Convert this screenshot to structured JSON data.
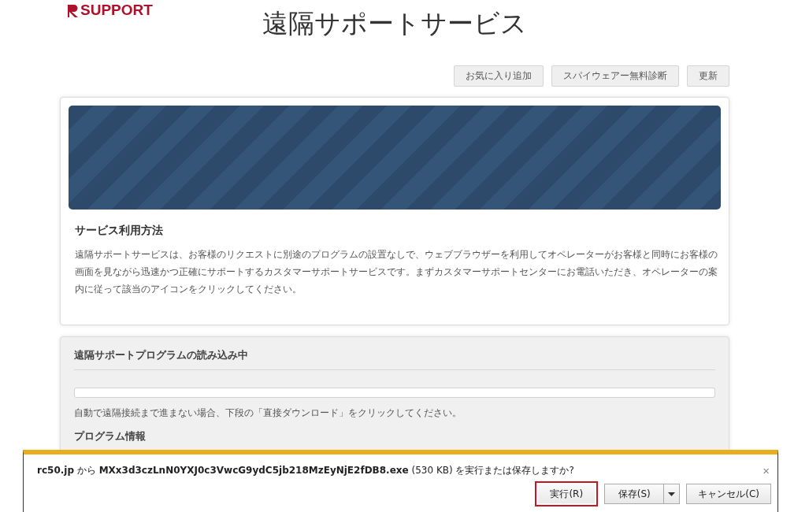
{
  "header": {
    "logo": "SUPPORT",
    "title": "遠隔サポートサービス"
  },
  "toolbar_buttons": [
    "お気に入り追加",
    "スパイウェアー無料診断",
    "更新"
  ],
  "usage_card": {
    "heading": "サービス利用方法",
    "body": "遠隔サポートサービスは、お客様のリクエストに別途のプログラムの設置なしで、ウェブブラウザーを利用してオペレーターがお客様と同時にお客様の画面を見ながら迅速かつ正確にサポートするカスタマーサポートサービスです。まずカスタマーサポートセンターにお電話いただき、オペレーターの案内に従って該当のアイコンをクリックしてください。"
  },
  "loading_card": {
    "heading": "遠隔サポートプログラムの読み込み中",
    "progress": {
      "level": 0
    },
    "note": "自動で遠隔接続まで進まない場合、下段の「直接ダウンロード」をクリックしてください。",
    "info_heading": "プログラム情報"
  },
  "download_bar": {
    "message": "**rc50.jp** から **MXx3d3czLnN0YXJ0c3VwcG9ydC5jb218MzEyNjE2fDB8.exe** (530 KB) を実行または保存しますか?",
    "close": "×",
    "buttons": [
      {
        "label": "実行(R)",
        "kind": "plain",
        "focused": true
      },
      {
        "label": "保存(S)",
        "kind": "split",
        "focused": false
      },
      {
        "label": "キャンセル(C)",
        "kind": "plain",
        "focused": false
      }
    ]
  }
}
